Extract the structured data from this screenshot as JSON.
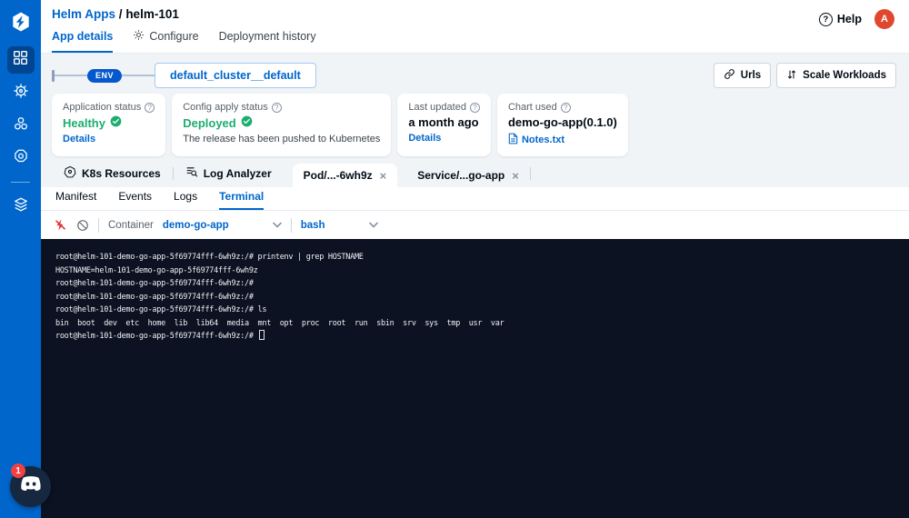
{
  "header": {
    "breadcrumb": {
      "parent": "Helm Apps",
      "separator": "/",
      "current": "helm-101"
    },
    "tabs": [
      {
        "label": "App details"
      },
      {
        "label": "Configure"
      },
      {
        "label": "Deployment history"
      }
    ],
    "help_label": "Help",
    "help_icon_glyph": "?",
    "avatar_initial": "A"
  },
  "env_bar": {
    "env_label": "ENV",
    "environment_name": "default_cluster__default",
    "urls_button": "Urls",
    "scale_workloads_button": "Scale Workloads"
  },
  "status_cards": {
    "app_status": {
      "label": "Application status",
      "value": "Healthy",
      "link": "Details"
    },
    "config_status": {
      "label": "Config apply status",
      "value": "Deployed",
      "description": "The release has been pushed to Kubernetes"
    },
    "last_updated": {
      "label": "Last updated",
      "value": "a month ago",
      "link": "Details"
    },
    "chart_used": {
      "label": "Chart used",
      "value": "demo-go-app(0.1.0)",
      "link": "Notes.txt"
    }
  },
  "resource_tabs": {
    "k8s_resources": "K8s Resources",
    "log_analyzer": "Log Analyzer",
    "pod_tab": "Pod/...-6wh9z",
    "service_tab": "Service/...go-app",
    "close_glyph": "×"
  },
  "pod_tabs": {
    "manifest": "Manifest",
    "events": "Events",
    "logs": "Logs",
    "terminal": "Terminal"
  },
  "terminal_toolbar": {
    "container_label": "Container",
    "container_value": "demo-go-app",
    "shell_value": "bash"
  },
  "terminal": {
    "lines": [
      "root@helm-101-demo-go-app-5f69774fff-6wh9z:/# printenv | grep HOSTNAME",
      "HOSTNAME=helm-101-demo-go-app-5f69774fff-6wh9z",
      "root@helm-101-demo-go-app-5f69774fff-6wh9z:/#",
      "root@helm-101-demo-go-app-5f69774fff-6wh9z:/#",
      "root@helm-101-demo-go-app-5f69774fff-6wh9z:/# ls",
      "bin  boot  dev  etc  home  lib  lib64  media  mnt  opt  proc  root  run  sbin  srv  sys  tmp  usr  var",
      "root@helm-101-demo-go-app-5f69774fff-6wh9z:/# "
    ]
  },
  "chat_widget": {
    "badge_count": "1"
  },
  "colors": {
    "sidebar_blue": "#0066cc",
    "accent_blue": "#0066cc",
    "status_green": "#1dad70",
    "terminal_bg": "#0c1221",
    "avatar_orange": "#e0482e",
    "badge_red": "#f23f42"
  }
}
